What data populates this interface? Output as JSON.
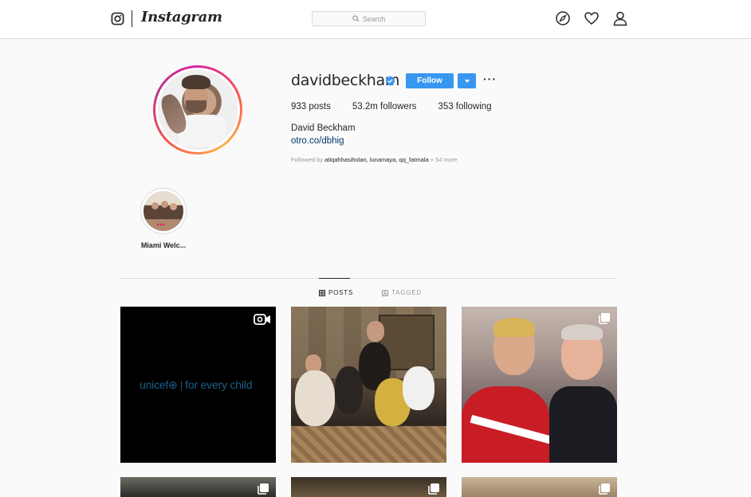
{
  "header": {
    "brand": "Instagram",
    "search_placeholder": "Search"
  },
  "profile": {
    "username": "davidbeckham",
    "verified": true,
    "follow_label": "Follow",
    "more_label": "···",
    "stats": {
      "posts": "933 posts",
      "followers": "53.2m followers",
      "following": "353 following"
    },
    "full_name": "David Beckham",
    "link": "otro.co/dbhig",
    "followed_by_prefix": "Followed by",
    "followed_by_names": "atiqahhasiholan, lunamaya, qq_fatmala",
    "followed_by_more": "+ 54 more"
  },
  "highlights": [
    {
      "label": "Miami Welc..."
    }
  ],
  "tabs": {
    "posts": "POSTS",
    "tagged": "TAGGED"
  },
  "posts": [
    {
      "type": "video",
      "overlay_text_brand": "unicef",
      "overlay_text_tag": "for every child"
    },
    {
      "type": "image"
    },
    {
      "type": "carousel"
    },
    {
      "type": "carousel"
    },
    {
      "type": "carousel"
    },
    {
      "type": "carousel"
    }
  ],
  "colors": {
    "accent": "#3897f0",
    "link": "#003569",
    "unicef_blue": "#1b5f8a"
  }
}
